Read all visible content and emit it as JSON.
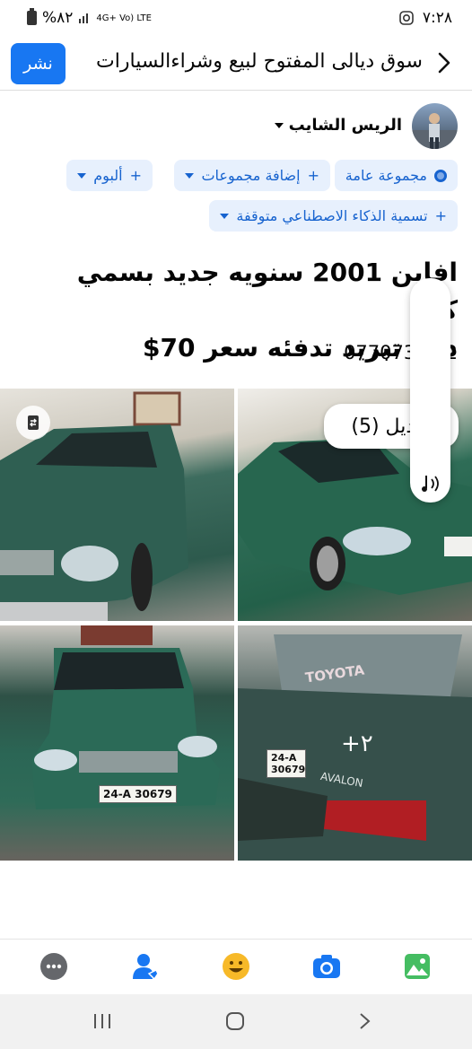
{
  "status_bar": {
    "time": "٧:٢٨",
    "battery": "%٨٢",
    "network": "4G+ Vo) LTE"
  },
  "header": {
    "title": "سوق ديالى المفتوح لبيع  وشراءالسيارات",
    "publish_label": "نشر"
  },
  "author": {
    "name": "الريس الشايب"
  },
  "chips": {
    "audience": "مجموعة عامة",
    "add_groups": "إضافة مجموعات",
    "album": "ألبوم",
    "ai_label": "تسمية الذكاء الاصطناعي متوقفة"
  },
  "post": {
    "line1": "افاين 2001 سنويه جديد بسمي كير",
    "line2": "دبله تبريد تدفئه سعر 70$",
    "phone": "07707347 2"
  },
  "photos": {
    "edit_label": "تعديل (5)",
    "more_count": "٢+",
    "plate_front": "24-A 30679",
    "plate_rear": "24-A 30679",
    "car_brand": "TOYOTA",
    "car_model": "AVALON"
  },
  "colors": {
    "accent": "#1877f2",
    "chip_bg": "#e7f0fd",
    "chip_text": "#1763cf"
  },
  "toolbar": {
    "icons": [
      "more-icon",
      "tag-people-icon",
      "feeling-icon",
      "camera-icon",
      "gallery-icon"
    ]
  }
}
